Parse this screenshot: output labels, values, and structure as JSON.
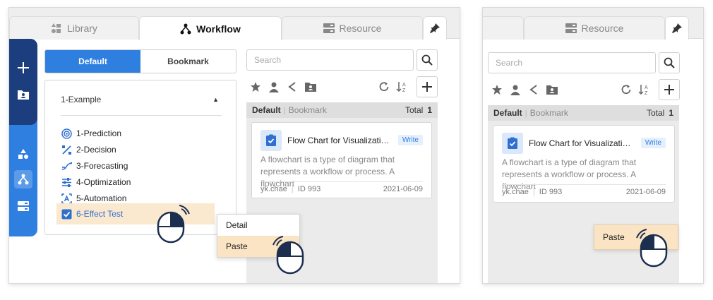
{
  "left": {
    "tabs": [
      {
        "label": "Library",
        "icon": "shapes-icon"
      },
      {
        "label": "Workflow",
        "icon": "workflow-icon"
      },
      {
        "label": "Resource",
        "icon": "server-icon"
      }
    ],
    "segment": {
      "default": "Default",
      "bookmark": "Bookmark"
    },
    "tree": {
      "root": "1-Example",
      "items": [
        {
          "label": "1-Prediction",
          "icon": "target-icon"
        },
        {
          "label": "2-Decision",
          "icon": "percent-icon"
        },
        {
          "label": "3-Forecasting",
          "icon": "trend-icon"
        },
        {
          "label": "4-Optimization",
          "icon": "sliders-icon"
        },
        {
          "label": "5-Automation",
          "icon": "automation-icon"
        },
        {
          "label": "6-Effect Test",
          "icon": "checkbox-icon"
        }
      ]
    },
    "search": {
      "placeholder": "Search"
    },
    "filter": {
      "default": "Default",
      "bookmark": "Bookmark",
      "total_label": "Total",
      "total": "1"
    },
    "card": {
      "title": "Flow Chart for Visualization...",
      "badge": "Write",
      "desc1": "A flowchart is a type of diagram that",
      "desc2": "represents a workflow or process. A flowchart",
      "user": "yk.chae",
      "id": "ID 993",
      "date": "2021-06-09"
    },
    "context_menu": {
      "detail": "Detail",
      "paste": "Paste"
    }
  },
  "right": {
    "tabs": [
      {
        "label": "Resource",
        "icon": "server-icon"
      }
    ],
    "search": {
      "placeholder": "Search"
    },
    "filter": {
      "default": "Default",
      "bookmark": "Bookmark",
      "total_label": "Total",
      "total": "1"
    },
    "card": {
      "title": "Flow Chart for Visualization...",
      "badge": "Write",
      "desc1": "A flowchart is a type of diagram that",
      "desc2": "represents a workflow or process. A flowchart",
      "user": "yk.chae",
      "id": "ID 993",
      "date": "2021-06-09"
    },
    "paste": "Paste"
  },
  "colors": {
    "accent": "#2f7fe0",
    "sidebar_dark": "#1c3d7e",
    "highlight": "#fbe4c3",
    "mouse": "#1c2f4f"
  }
}
